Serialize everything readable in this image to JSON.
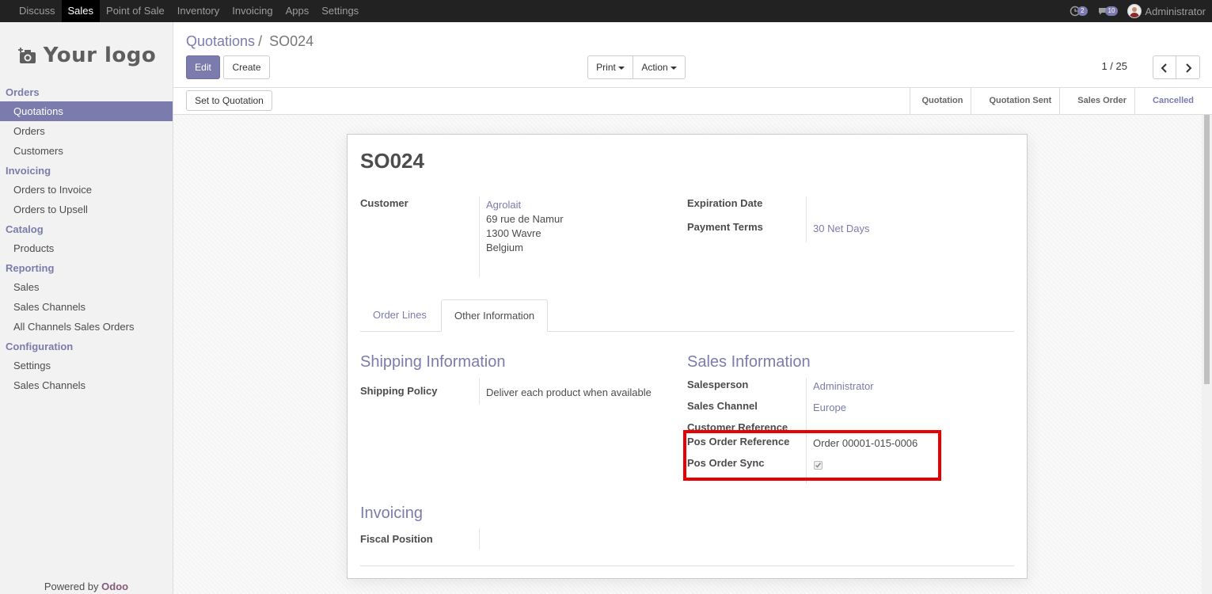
{
  "topbar": {
    "apps": [
      "Discuss",
      "Sales",
      "Point of Sale",
      "Inventory",
      "Invoicing",
      "Apps",
      "Settings"
    ],
    "active_app": "Sales",
    "activity_count": "2",
    "message_count": "10",
    "user": "Administrator"
  },
  "sidebar": {
    "logo_text": "Your logo",
    "sections": [
      {
        "title": "Orders",
        "items": [
          "Quotations",
          "Orders",
          "Customers"
        ]
      },
      {
        "title": "Invoicing",
        "items": [
          "Orders to Invoice",
          "Orders to Upsell"
        ]
      },
      {
        "title": "Catalog",
        "items": [
          "Products"
        ]
      },
      {
        "title": "Reporting",
        "items": [
          "Sales",
          "Sales Channels",
          "All Channels Sales Orders"
        ]
      },
      {
        "title": "Configuration",
        "items": [
          "Settings",
          "Sales Channels"
        ]
      }
    ],
    "active_item": "Quotations",
    "powered_by": "Powered by",
    "powered_brand": "Odoo"
  },
  "control_panel": {
    "breadcrumb_parent": "Quotations",
    "breadcrumb_sep": "/",
    "breadcrumb_current": "SO024",
    "edit_label": "Edit",
    "create_label": "Create",
    "print_label": "Print",
    "action_label": "Action",
    "pager": "1 / 25"
  },
  "statusbar": {
    "set_to_quotation_label": "Set to Quotation",
    "stages": [
      "Quotation",
      "Quotation Sent",
      "Sales Order",
      "Cancelled"
    ],
    "active_stage": "Cancelled"
  },
  "form": {
    "name": "SO024",
    "customer_label": "Customer",
    "customer_name": "Agrolait",
    "customer_address": [
      "69 rue de Namur",
      "1300 Wavre",
      "Belgium"
    ],
    "expiration_label": "Expiration Date",
    "expiration_value": "",
    "payment_terms_label": "Payment Terms",
    "payment_terms_value": "30 Net Days",
    "tabs": [
      "Order Lines",
      "Other Information"
    ],
    "active_tab": "Other Information",
    "shipping": {
      "title": "Shipping Information",
      "policy_label": "Shipping Policy",
      "policy_value": "Deliver each product when available"
    },
    "sales_info": {
      "title": "Sales Information",
      "salesperson_label": "Salesperson",
      "salesperson_value": "Administrator",
      "channel_label": "Sales Channel",
      "channel_value": "Europe",
      "customer_ref_label": "Customer Reference",
      "pos_ref_label": "Pos Order Reference",
      "pos_ref_value": "Order 00001-015-0006",
      "pos_sync_label": "Pos Order Sync",
      "pos_sync_checked": true
    },
    "invoicing": {
      "title": "Invoicing",
      "fiscal_position_label": "Fiscal Position"
    }
  },
  "colors": {
    "accent": "#7c7bad",
    "highlight": "#e90000",
    "topbar": "#222222"
  }
}
